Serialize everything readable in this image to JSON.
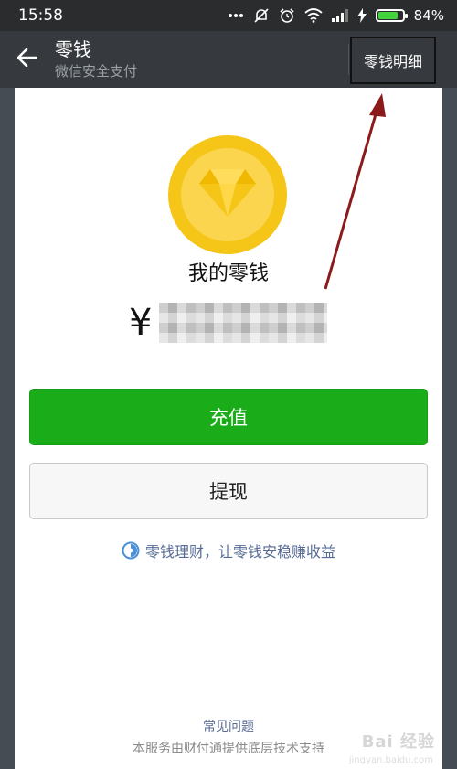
{
  "status_bar": {
    "time": "15:58",
    "battery_percent_label": "84%",
    "battery_level": 0.84,
    "icons": [
      "more-dots-icon",
      "do-not-disturb-icon",
      "alarm-icon",
      "wifi-icon",
      "signal-icon",
      "charging-icon",
      "battery-icon"
    ]
  },
  "nav": {
    "title": "零钱",
    "subtitle": "微信安全支付",
    "action_label": "零钱明细",
    "back_icon": "back-arrow-icon"
  },
  "wallet": {
    "title": "我的零钱",
    "currency_symbol": "¥",
    "amount": "",
    "coin_icon": "diamond-icon"
  },
  "buttons": {
    "recharge": "充值",
    "withdraw": "提现"
  },
  "promo": {
    "text": "零钱理财，让零钱安稳赚收益",
    "icon": "wealth-icon"
  },
  "footer": {
    "faq": "常见问题",
    "support": "本服务由财付通提供底层技术支持"
  },
  "watermark": {
    "brand": "Bai 经验",
    "url": "jingyan.baidu.com"
  },
  "colors": {
    "primary_green": "#1aad19",
    "link_blue": "#576b95",
    "nav_bg": "#363a3e",
    "coin_gold": "#f5c518",
    "annotation_red": "#8b1a1a"
  }
}
